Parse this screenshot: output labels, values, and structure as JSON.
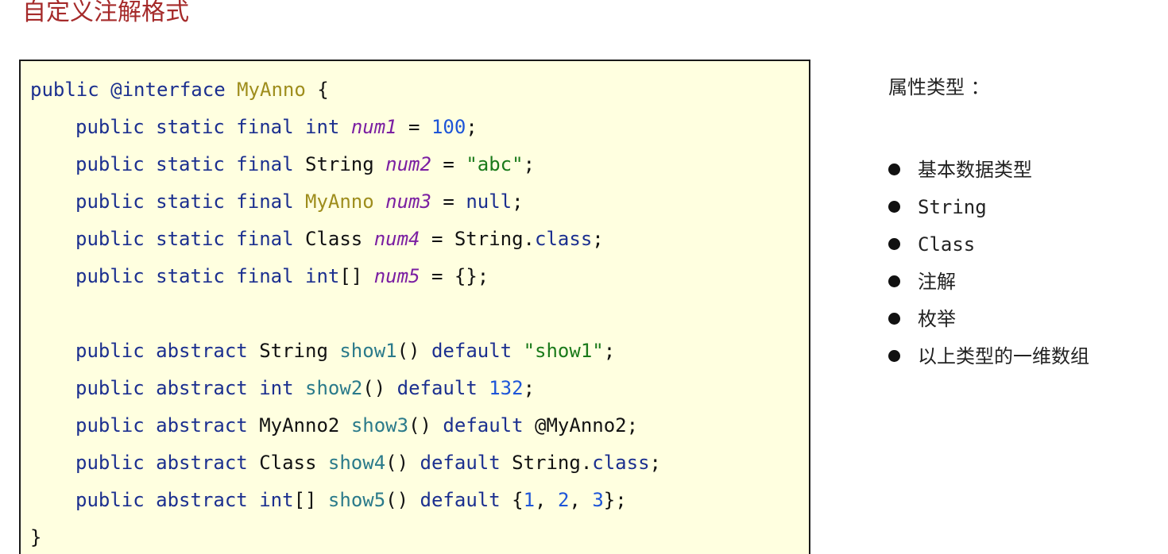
{
  "title": "自定义注解格式",
  "code": {
    "line1": {
      "public": "public",
      "interface": "@interface",
      "name": "MyAnno",
      "brace": " {"
    },
    "line2": {
      "mods": "public static final",
      "type": "int",
      "var": "num1",
      "eq": " = ",
      "value": "100",
      "end": ";"
    },
    "line3": {
      "mods": "public static final",
      "type": "String",
      "var": "num2",
      "eq": " = ",
      "value": "\"abc\"",
      "end": ";"
    },
    "line4": {
      "mods": "public static final",
      "type": "MyAnno",
      "var": "num3",
      "eq": " = ",
      "value": "null",
      "end": ";"
    },
    "line5": {
      "mods": "public static final",
      "type": "Class",
      "var": "num4",
      "eq": " = ",
      "value_obj": "String.",
      "value_kw": "class",
      "end": ";"
    },
    "line6": {
      "mods": "public static final",
      "type": "int",
      "type_suffix": "[]",
      "var": "num5",
      "eq": " = ",
      "value": "{}",
      "end": ";"
    },
    "line7": {
      "mods": "public abstract",
      "type": "String",
      "method": "show1",
      "parens": "()",
      "default": "default",
      "value": "\"show1\"",
      "end": ";"
    },
    "line8": {
      "mods": "public abstract",
      "type": "int",
      "method": "show2",
      "parens": "()",
      "default": "default",
      "value": "132",
      "end": ";"
    },
    "line9": {
      "mods": "public abstract",
      "type": "MyAnno2",
      "method": "show3",
      "parens": "()",
      "default": "default",
      "value": "@MyAnno2",
      "end": ";"
    },
    "line10": {
      "mods": "public abstract",
      "type": "Class",
      "method": "show4",
      "parens": "()",
      "default": "default",
      "value_obj": "String.",
      "value_kw": "class",
      "end": ";"
    },
    "line11": {
      "mods": "public abstract",
      "type": "int",
      "type_suffix": "[]",
      "method": "show5",
      "parens": "()",
      "default": "default",
      "v_open": "{",
      "v1": "1",
      "v2": "2",
      "v3": "3",
      "v_close": "}",
      "end": ";"
    },
    "line12": {
      "brace": "}"
    }
  },
  "sidebar": {
    "title": "属性类型 ：",
    "items": [
      "基本数据类型",
      "String",
      "Class",
      "注解",
      "枚举",
      "以上类型的一维数组"
    ]
  }
}
